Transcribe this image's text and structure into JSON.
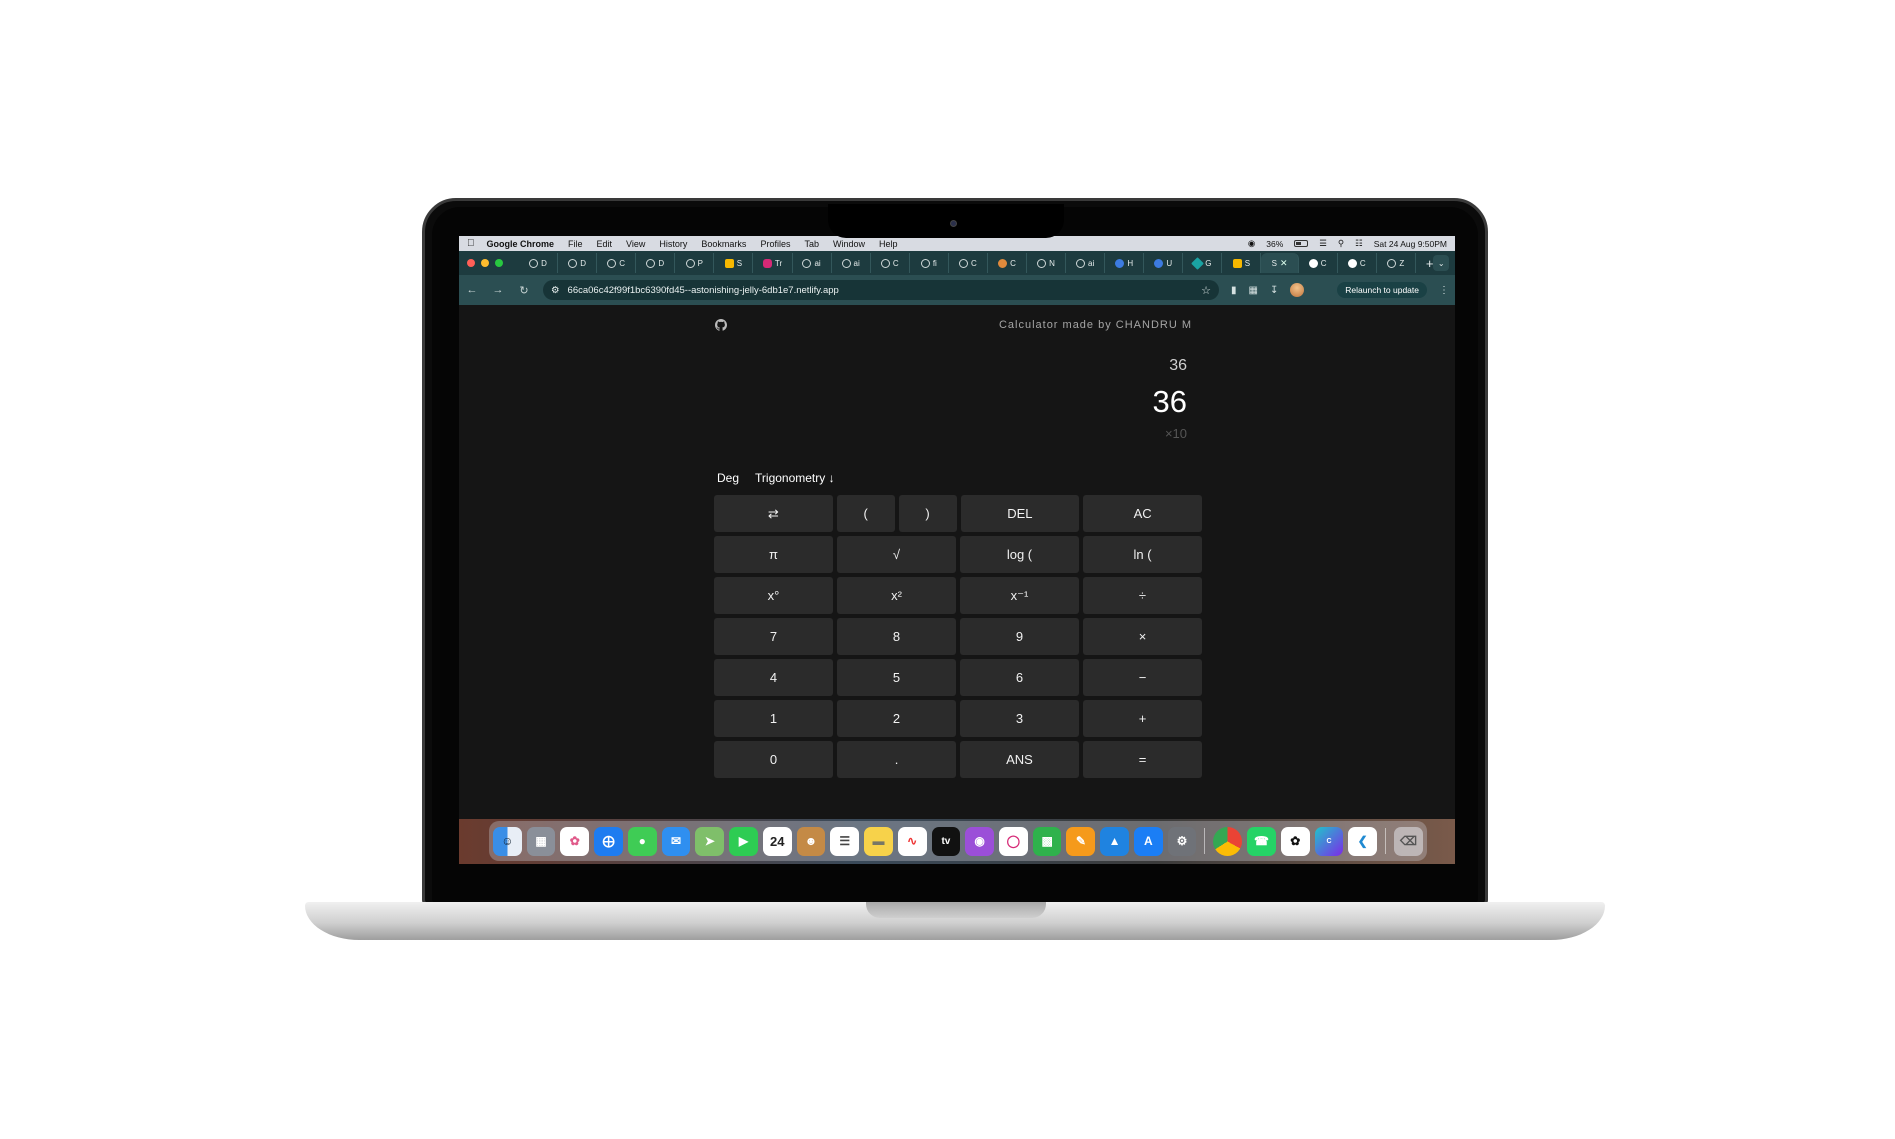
{
  "menubar": {
    "app_name": "Google Chrome",
    "items": [
      "File",
      "Edit",
      "View",
      "History",
      "Bookmarks",
      "Profiles",
      "Tab",
      "Window",
      "Help"
    ],
    "battery": "36%",
    "clock": "Sat 24 Aug  9:50PM"
  },
  "tabs": [
    {
      "label": "D"
    },
    {
      "label": "D"
    },
    {
      "label": "C"
    },
    {
      "label": "D"
    },
    {
      "label": "P"
    },
    {
      "label": "S"
    },
    {
      "label": "Tr"
    },
    {
      "label": "ai"
    },
    {
      "label": "ai"
    },
    {
      "label": "C"
    },
    {
      "label": "fi"
    },
    {
      "label": "C"
    },
    {
      "label": "C"
    },
    {
      "label": "N"
    },
    {
      "label": "ai"
    },
    {
      "label": "H"
    },
    {
      "label": "U"
    },
    {
      "label": "G"
    },
    {
      "label": "S"
    },
    {
      "label": "S"
    },
    {
      "label": "C"
    },
    {
      "label": "C"
    },
    {
      "label": "Z"
    }
  ],
  "address_bar": {
    "url": "66ca06c42f99f1bc6390fd45--astonishing-jelly-6db1e7.netlify.app",
    "relaunch": "Relaunch to update"
  },
  "calculator": {
    "credit": "Calculator made by CHANDRU M",
    "previous": "36",
    "result": "36",
    "hint": "×10",
    "angle_mode": "Deg",
    "trig_menu": "Trigonometry ↓",
    "rows": [
      [
        "⇄",
        "(",
        ")",
        "DEL",
        "AC"
      ],
      [
        "π",
        "√",
        "log (",
        "ln ("
      ],
      [
        "x°",
        "x²",
        "x⁻¹",
        "÷"
      ],
      [
        "7",
        "8",
        "9",
        "×"
      ],
      [
        "4",
        "5",
        "6",
        "−"
      ],
      [
        "1",
        "2",
        "3",
        "+"
      ],
      [
        "0",
        ".",
        "ANS",
        "="
      ]
    ]
  },
  "dock": {
    "calendar_day": "24",
    "appletv": "tv"
  },
  "colors": {
    "page_bg": "#151515",
    "key_bg": "#2b2b2b",
    "tabstrip": "#1d3b3f",
    "toolbar": "#2b4e52"
  }
}
